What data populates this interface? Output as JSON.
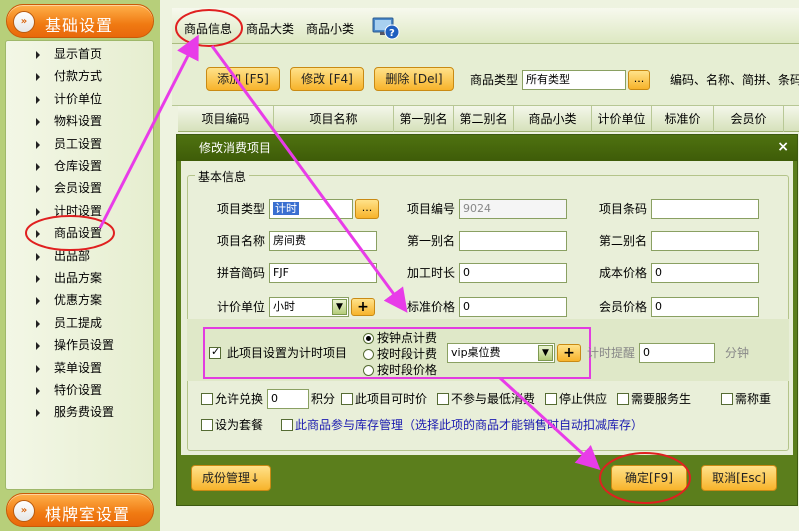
{
  "sidebar": {
    "top_section": {
      "label": "基础设置",
      "icon": "double-chevron-right-icon"
    },
    "bottom_section": {
      "label": "棋牌室设置",
      "icon": "double-chevron-right-icon"
    },
    "items": [
      {
        "label": "显示首页"
      },
      {
        "label": "付款方式"
      },
      {
        "label": "计价单位"
      },
      {
        "label": "物料设置"
      },
      {
        "label": "员工设置"
      },
      {
        "label": "仓库设置"
      },
      {
        "label": "会员设置"
      },
      {
        "label": "计时设置"
      },
      {
        "label": "商品设置"
      },
      {
        "label": "出品部"
      },
      {
        "label": "出品方案"
      },
      {
        "label": "优惠方案"
      },
      {
        "label": "员工提成"
      },
      {
        "label": "操作员设置"
      },
      {
        "label": "菜单设置"
      },
      {
        "label": "特价设置"
      },
      {
        "label": "服务费设置"
      }
    ]
  },
  "tabs": [
    {
      "label": "商品信息",
      "active": true
    },
    {
      "label": "商品大类",
      "active": false
    },
    {
      "label": "商品小类",
      "active": false
    }
  ],
  "toolbar": {
    "add_label": "添加 [F5]",
    "edit_label": "修改 [F4]",
    "delete_label": "删除 [Del]",
    "type_label": "商品类型",
    "type_value": "所有类型",
    "dots_label": "...",
    "search_hint": "编码、名称、简拼、条码"
  },
  "grid": {
    "columns": [
      "项目编码",
      "项目名称",
      "第一别名",
      "第二别名",
      "商品小类",
      "计价单位",
      "标准价",
      "会员价"
    ]
  },
  "dialog": {
    "title": "修改消费项目",
    "close_label": "×",
    "group_label": "基本信息",
    "fields": {
      "item_type_label": "项目类型",
      "item_type_value": "计时",
      "item_code_label": "项目编号",
      "item_code_value": "9024",
      "barcode_label": "项目条码",
      "barcode_value": "",
      "item_name_label": "项目名称",
      "item_name_value": "房间费",
      "alias1_label": "第一别名",
      "alias1_value": "",
      "alias2_label": "第二别名",
      "alias2_value": "",
      "pinyin_label": "拼音简码",
      "pinyin_value": "FJF",
      "processing_time_label": "加工时长",
      "processing_time_value": "0",
      "cost_price_label": "成本价格",
      "cost_price_value": "0",
      "unit_label": "计价单位",
      "unit_value": "小时",
      "std_price_label": "标准价格",
      "std_price_value": "0",
      "member_price_label": "会员价格",
      "member_price_value": "0"
    },
    "timed": {
      "checkbox_label": "此项目设置为计时项目",
      "checked": true,
      "options": [
        "按钟点计费",
        "按时段计费",
        "按时段价格"
      ],
      "selected_option": "按钟点计费",
      "plan_value": "vip桌位费",
      "remind_label": "计时提醒",
      "remind_value": "0",
      "remind_unit": "分钟"
    },
    "options_row1": [
      {
        "label": "允许兑换",
        "checked": false
      },
      {
        "label": "积分",
        "checked": false
      },
      {
        "label": "此项目可时价",
        "checked": false
      },
      {
        "label": "不参与最低消费",
        "checked": false
      },
      {
        "label": "停止供应",
        "checked": false
      },
      {
        "label": "需要服务生",
        "checked": false
      },
      {
        "label": "需称重",
        "checked": false
      }
    ],
    "exchange_points_value": "0",
    "options_row2": [
      {
        "label": "设为套餐",
        "checked": false
      },
      {
        "label": "此商品参与库存管理（选择此项的商品才能销售时自动扣减库存）",
        "checked": false
      }
    ],
    "cost_mgmt_label": "成份管理↓",
    "ok_label": "确定[F9]",
    "cancel_label": "取消[Esc]"
  },
  "colors": {
    "accent_orange": "#f07a12",
    "annotation_magenta": "#e83ce8",
    "annotation_red": "#e02020",
    "dialog_green": "#5b7e1c"
  }
}
